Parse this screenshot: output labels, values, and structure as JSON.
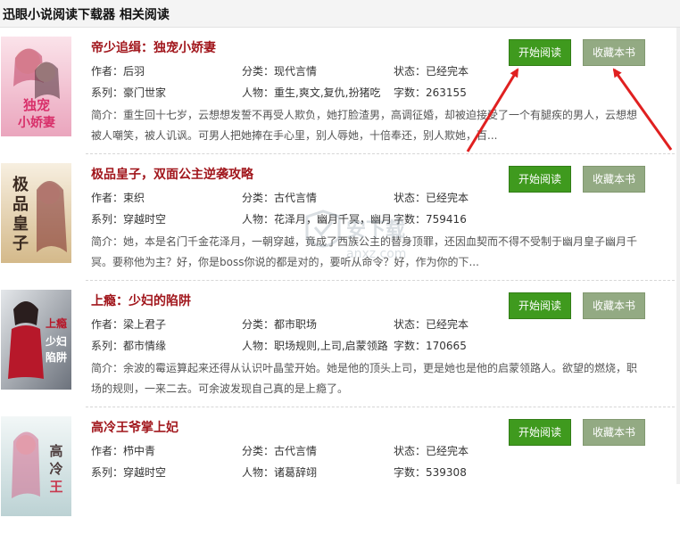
{
  "window": {
    "title": "迅眼小说阅读下载器  相关阅读"
  },
  "labels": {
    "author": "作者：",
    "category": "分类：",
    "status": "状态：",
    "series": "系列：",
    "characters": "人物：",
    "wordcount": "字数：",
    "intro": "简介："
  },
  "buttons": {
    "read": "开始阅读",
    "favorite": "收藏本书"
  },
  "books": [
    {
      "title": "帝少追缉：独宠小娇妻",
      "author": "后羽",
      "category": "现代言情",
      "status": "已经完本",
      "series": "豪门世家",
      "characters": "重生,爽文,复仇,扮猪吃",
      "wordcount": "263155",
      "intro": "重生回十七岁，云想想发誓不再受人欺负，她打脸渣男，高调征婚，却被迫接受了一个有腿疾的男人，云想想被人嘲笑，被人讥讽。可男人把她捧在手心里，别人辱她，十倍奉还，别人欺她，百...",
      "cover_text": "独宠小娇妻",
      "cover_colors": [
        "#f7d7e0",
        "#e9a0b8"
      ]
    },
    {
      "title": "极品皇子，双面公主逆袭攻略",
      "author": "束织",
      "category": "古代言情",
      "status": "已经完本",
      "series": "穿越时空",
      "characters": "花泽月，幽月千冥，幽月",
      "wordcount": "759416",
      "intro": "她，本是名门千金花泽月，一朝穿越，竟成了西族公主的替身顶罪，还因血契而不得不受制于幽月皇子幽月千冥。要称他为主？好，你是boss你说的都是对的，要听从命令？好，作为你的下...",
      "cover_text": "极品皇子",
      "cover_colors": [
        "#f3ead8",
        "#d9c39c"
      ]
    },
    {
      "title": "上瘾：少妇的陷阱",
      "author": "梁上君子",
      "category": "都市职场",
      "status": "已经完本",
      "series": "都市情缘",
      "characters": "职场规则,上司,启蒙领路",
      "wordcount": "170665",
      "intro": "余波的霉运算起来还得从认识叶晶莹开始。她是他的顶头上司，更是她也是他的启蒙领路人。欲望的燃烧，职场的规则，一来二去。可余波发现自己真的是上瘾了。",
      "cover_text": "上瘾少妇的陷阱",
      "cover_colors": [
        "#d9dde2",
        "#7a7f88"
      ]
    },
    {
      "title": "高冷王爷掌上妃",
      "author": "栉中青",
      "category": "古代言情",
      "status": "已经完本",
      "series": "穿越时空",
      "characters": "诸葛辞翊",
      "wordcount": "539308",
      "intro": "",
      "cover_text": "高冷王爷",
      "cover_colors": [
        "#eaf2f2",
        "#c2d6d8"
      ]
    }
  ],
  "watermark": {
    "text": "安下载",
    "sub": "anxz.com"
  },
  "colors": {
    "title_red": "#a1161c",
    "read_green": "#3f9a1e",
    "fav_gray_green": "#93aa83",
    "arrow_red": "#e02020"
  }
}
